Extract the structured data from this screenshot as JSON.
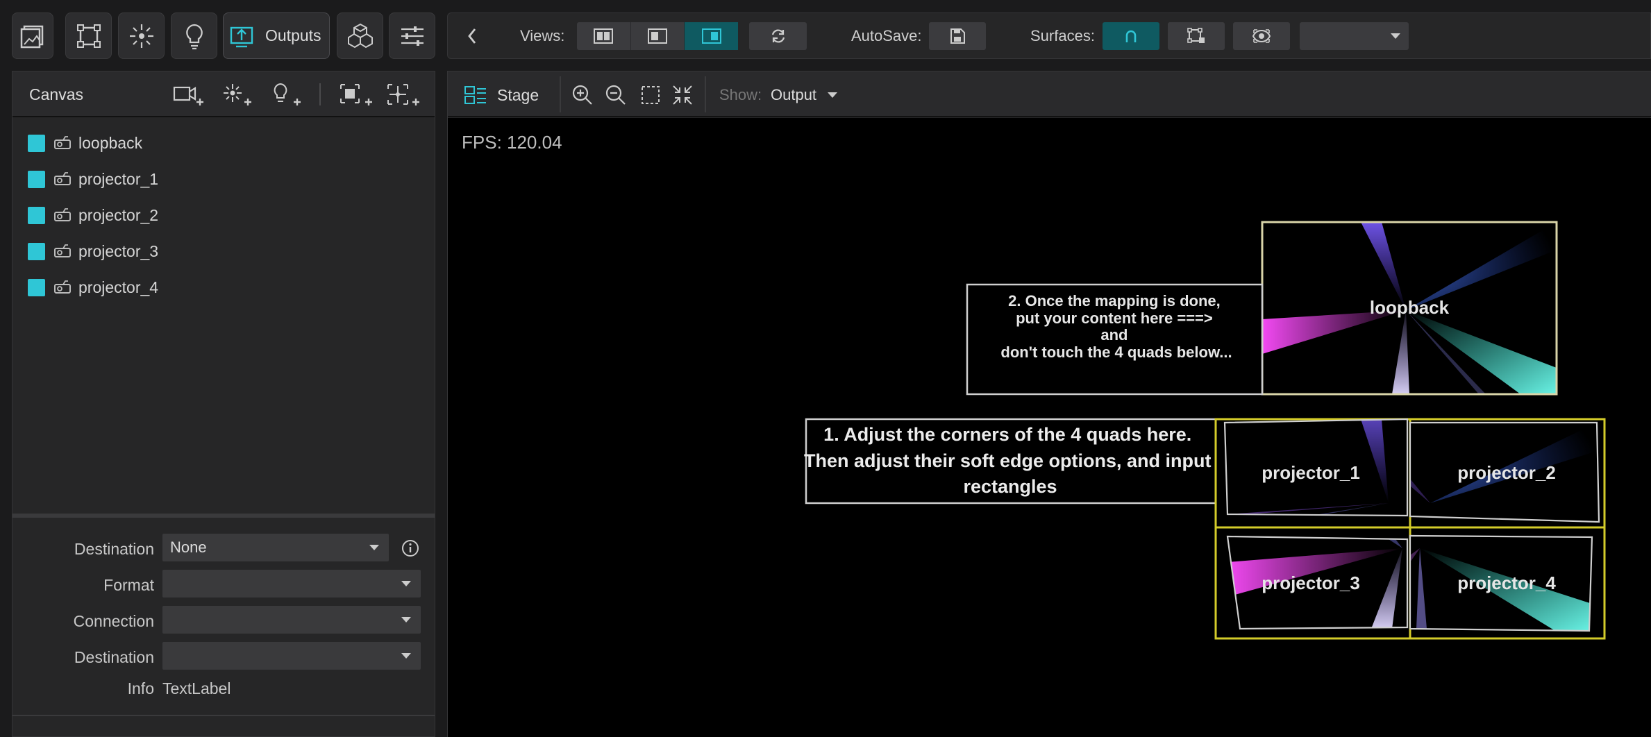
{
  "toolbar": {
    "outputs_label": "Outputs",
    "views_label": "Views:",
    "autosave_label": "AutoSave:",
    "surfaces_label": "Surfaces:",
    "icons": [
      "gallery-icon",
      "surface-icon",
      "light-rays-icon",
      "bulb-icon",
      "outputs-icon",
      "cubes-icon",
      "sliders-icon"
    ]
  },
  "canvas": {
    "title": "Canvas",
    "items": [
      {
        "label": "loopback"
      },
      {
        "label": "projector_1"
      },
      {
        "label": "projector_2"
      },
      {
        "label": "projector_3"
      },
      {
        "label": "projector_4"
      }
    ],
    "accent": "#2fc6d6"
  },
  "props": {
    "destination_label": "Destination",
    "destination_value": "None",
    "format_label": "Format",
    "connection_label": "Connection",
    "destination2_label": "Destination",
    "info_label": "Info",
    "info_value": "TextLabel"
  },
  "stage": {
    "tab_label": "Stage",
    "show_label": "Show:",
    "show_value": "Output",
    "fps": "FPS: 120.04",
    "note2": [
      "2. Once the mapping is done,",
      "put your content here ===>",
      "and",
      "don't touch the 4 quads below..."
    ],
    "note1": [
      "1. Adjust the corners of the 4 quads here.",
      "Then adjust their soft edge options, and input",
      "rectangles"
    ],
    "quads": {
      "loopback": "loopback",
      "p1": "projector_1",
      "p2": "projector_2",
      "p3": "projector_3",
      "p4": "projector_4"
    },
    "grid_color": "#d4cc2a"
  }
}
